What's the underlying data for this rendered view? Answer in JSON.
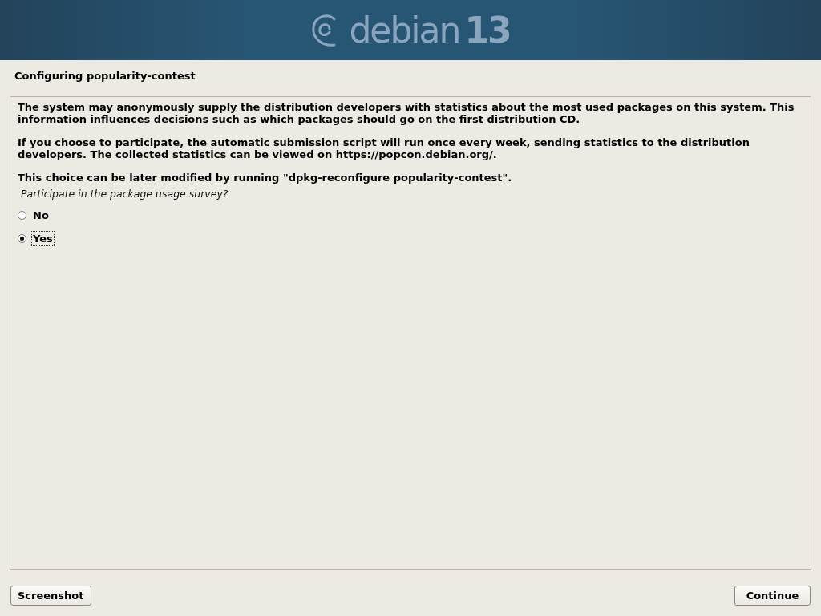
{
  "banner": {
    "logo_word": "debian",
    "logo_version": "13"
  },
  "title": "Configuring popularity-contest",
  "paragraphs": [
    "The system may anonymously supply the distribution developers with statistics about the most used packages on this system. This information influences decisions such as which packages should go on the first distribution CD.",
    "If you choose to participate, the automatic submission script will run once every week, sending statistics to the distribution developers. The collected statistics can be viewed on https://popcon.debian.org/.",
    "This choice can be later modified by running \"dpkg-reconfigure popularity-contest\"."
  ],
  "question": "Participate in the package usage survey?",
  "options": [
    {
      "label": "No",
      "selected": false,
      "focused": false
    },
    {
      "label": "Yes",
      "selected": true,
      "focused": true
    }
  ],
  "buttons": {
    "left": "Screenshot",
    "right": "Continue"
  }
}
